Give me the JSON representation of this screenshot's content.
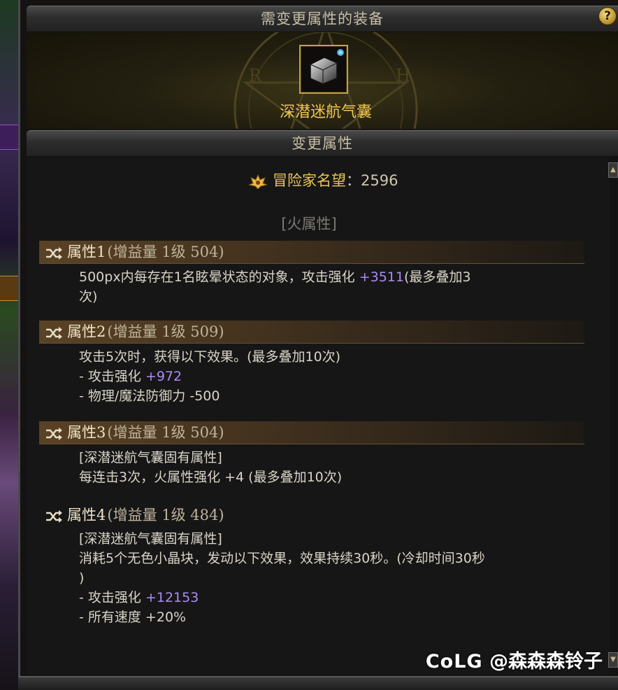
{
  "window": {
    "equip_header": "需变更属性的装备",
    "attr_header": "变更属性",
    "help_label": "?"
  },
  "item": {
    "name": "深潜迷航气囊",
    "icon": "equipment-cube-icon",
    "name_color": "#f0c64c"
  },
  "fame": {
    "icon": "fame-crown-icon",
    "label": "冒险家名望",
    "separator": "：",
    "value": "2596"
  },
  "element_label": "[火属性]",
  "attributes": [
    {
      "icon": "shuffle-icon",
      "name": "属性1",
      "meta": "(增益量 1级 504)",
      "lines": [
        {
          "text": "500px内每存在1名眩晕状态的对象，攻击强化 ",
          "highlight": "+3511",
          "suffix": "(最多叠加3"
        },
        {
          "text": "次)",
          "highlight": "",
          "suffix": ""
        }
      ]
    },
    {
      "icon": "shuffle-icon",
      "name": "属性2",
      "meta": "(增益量 1级 509)",
      "lines": [
        {
          "text": "攻击5次时，获得以下效果。(最多叠加10次)",
          "highlight": "",
          "suffix": ""
        },
        {
          "text": "- 攻击强化 ",
          "highlight": "+972",
          "suffix": ""
        },
        {
          "text": "- 物理/魔法防御力 -500",
          "highlight": "",
          "suffix": ""
        }
      ]
    },
    {
      "icon": "shuffle-icon",
      "name": "属性3",
      "meta": "(增益量 1级 504)",
      "lines": [
        {
          "text": "[深潜迷航气囊固有属性]",
          "highlight": "",
          "suffix": ""
        },
        {
          "text": "每连击3次，火属性强化 +4 (最多叠加10次)",
          "highlight": "",
          "suffix": ""
        }
      ]
    },
    {
      "icon": "shuffle-icon",
      "name": "属性4",
      "meta": "(增益量 1级 484)",
      "lines": [
        {
          "text": "[深潜迷航气囊固有属性]",
          "highlight": "",
          "suffix": ""
        },
        {
          "text": "消耗5个无色小晶块，发动以下效果，效果持续30秒。(冷却时间30秒",
          "highlight": "",
          "suffix": ""
        },
        {
          "text": ")",
          "highlight": "",
          "suffix": ""
        },
        {
          "text": "- 攻击强化 ",
          "highlight": "+12153",
          "suffix": ""
        },
        {
          "text": "- 所有速度 +20%",
          "highlight": "",
          "suffix": ""
        }
      ]
    }
  ],
  "watermark": {
    "logo": "CoLG",
    "author": "@森森森铃子"
  },
  "colors": {
    "highlight_purple": "#a98cf2",
    "gold": "#e8c658"
  }
}
